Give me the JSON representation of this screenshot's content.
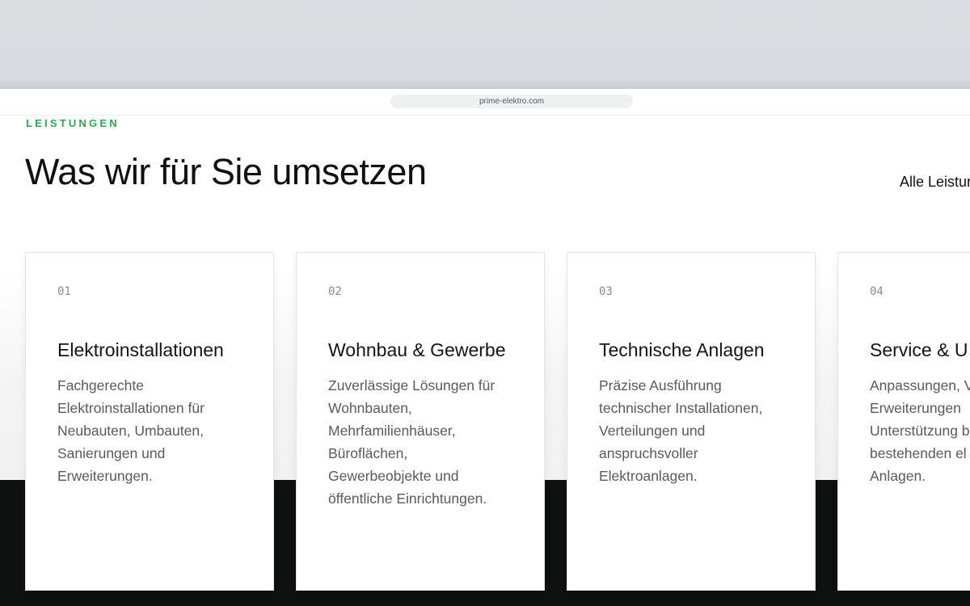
{
  "browser": {
    "url": "prime-elektro.com"
  },
  "section": {
    "eyebrow": "LEISTUNGEN",
    "title": "Was wir für Sie umsetzen",
    "all_link": "Alle Leistungen"
  },
  "cards": [
    {
      "number": "01",
      "title": "Elektroinstallationen",
      "lines": [
        "Fachgerechte",
        "Elektroinstallationen für",
        "Neubauten, Umbauten,",
        "Sanierungen und",
        "Erweiterungen."
      ]
    },
    {
      "number": "02",
      "title": "Wohnbau & Gewerbe",
      "lines": [
        "Zuverlässige Lösungen für",
        "Wohnbauten,",
        "Mehrfamilienhäuser,",
        "Büroflächen,",
        "Gewerbeobjekte und",
        "öffentliche Einrichtungen."
      ]
    },
    {
      "number": "03",
      "title": "Technische Anlagen",
      "lines": [
        "Präzise Ausführung",
        "technischer Installationen,",
        "Verteilungen und",
        "anspruchsvoller",
        "Elektroanlagen."
      ]
    },
    {
      "number": "04",
      "title": "Service & U",
      "lines": [
        "Anpassungen, V",
        "Erweiterungen",
        "Unterstützung b",
        "bestehenden el",
        "Anlagen."
      ]
    }
  ],
  "colors": {
    "accent": "#2fa84f",
    "dark_band": "#0f1110",
    "chrome": "#d8dbdf"
  }
}
